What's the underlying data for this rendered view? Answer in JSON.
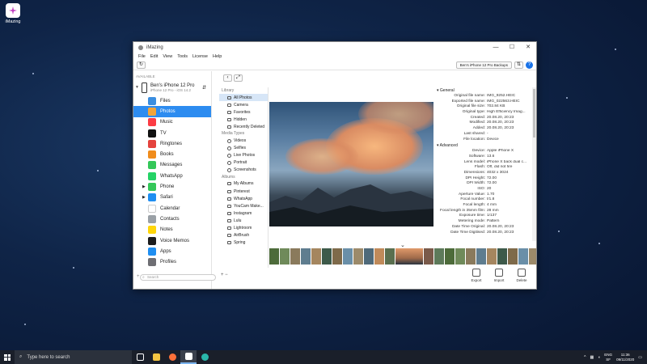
{
  "desktop": {
    "icon_label": "iMazing"
  },
  "window": {
    "title": "iMazing",
    "controls": {
      "minimize": "—",
      "maximize": "☐",
      "close": "✕"
    }
  },
  "menu": [
    "File",
    "Edit",
    "View",
    "Tools",
    "License",
    "Help"
  ],
  "toolbar": {
    "backup_label": "Ben's iPhone 12 Pro Backups"
  },
  "sidebar": {
    "available_label": "AVAILABLE",
    "device_name": "Ben's iPhone 12 Pro",
    "device_sub": "iPhone 12 Pro - iOS 14.2",
    "items": [
      {
        "label": "Files",
        "color": "#3b8ee0",
        "icon": "folder-icon"
      },
      {
        "label": "Photos",
        "color": "#f2a43a",
        "icon": "photos-icon"
      },
      {
        "label": "Music",
        "color": "#fc3c44",
        "icon": "music-icon"
      },
      {
        "label": "TV",
        "color": "#111111",
        "icon": "tv-icon"
      },
      {
        "label": "Ringtones",
        "color": "#e4433d",
        "icon": "ringtones-icon"
      },
      {
        "label": "Books",
        "color": "#f08c1c",
        "icon": "books-icon"
      },
      {
        "label": "Messages",
        "color": "#34c759",
        "icon": "messages-icon"
      },
      {
        "label": "WhatsApp",
        "color": "#25d366",
        "icon": "whatsapp-icon"
      },
      {
        "label": "Phone",
        "color": "#34c759",
        "icon": "phone-icon"
      },
      {
        "label": "Safari",
        "color": "#1f8ef1",
        "icon": "safari-icon"
      },
      {
        "label": "Calendar",
        "color": "#ffffff",
        "icon": "calendar-icon"
      },
      {
        "label": "Contacts",
        "color": "#9aa0a6",
        "icon": "contacts-icon"
      },
      {
        "label": "Notes",
        "color": "#ffd60a",
        "icon": "notes-icon"
      },
      {
        "label": "Voice Memos",
        "color": "#1c1c1e",
        "icon": "voice-memos-icon"
      },
      {
        "label": "Apps",
        "color": "#1f8ef1",
        "icon": "apps-icon"
      },
      {
        "label": "Profiles",
        "color": "#6e6e73",
        "icon": "profiles-icon"
      }
    ],
    "search_placeholder": "Search"
  },
  "library": {
    "library_header": "Library",
    "library_items": [
      "All Photos",
      "Camera",
      "Favorites",
      "Hidden",
      "Recently Deleted"
    ],
    "media_header": "Media Types",
    "media_items": [
      "Videos",
      "Selfies",
      "Live Photos",
      "Portrait",
      "Screenshots"
    ],
    "albums_header": "Albums",
    "album_items": [
      "My Albums",
      "Pinterest",
      "WhatsApp",
      "YouCam Make...",
      "Instagram",
      "Lulu",
      "Lightroom",
      "AirBrush",
      "Spring"
    ]
  },
  "info": {
    "general_header": "General",
    "general": [
      [
        "Original file name:",
        "IMG_9252.HEIC"
      ],
      [
        "Exported file name:",
        "IMG_022563.HEIC"
      ],
      [
        "Original file size:",
        "702.84 KB"
      ],
      [
        "Original type:",
        "High Efficiency Imag..."
      ],
      [
        "Created:",
        "20.08.20, 20:23"
      ],
      [
        "Modified:",
        "20.08.20, 20:23"
      ],
      [
        "Added:",
        "20.08.20, 20:23"
      ],
      [
        "Last shared:",
        "-"
      ],
      [
        "File location:",
        "Device"
      ]
    ],
    "advanced_header": "Advanced",
    "advanced": [
      [
        "Device:",
        "Apple iPhone X"
      ],
      [
        "Software:",
        "13.6"
      ],
      [
        "Lens model:",
        "iPhone X back dual c..."
      ],
      [
        "Flash:",
        "Off, did not fire"
      ],
      [
        "Dimensions:",
        "4032 x 3024"
      ],
      [
        "DPI Height:",
        "72.00"
      ],
      [
        "DPI Width:",
        "72.00"
      ],
      [
        "ISO:",
        "20"
      ],
      [
        "Aperture Value:",
        "1.70"
      ],
      [
        "Focal number:",
        "f/1.8"
      ],
      [
        "Focal length:",
        "4 mm"
      ],
      [
        "Focal length in 35mm film:",
        "28 mm"
      ],
      [
        "Exposure time:",
        "1/137"
      ],
      [
        "Metering mode:",
        "Pattern"
      ],
      [
        "Date Time Original:",
        "20.08.20, 20:23"
      ],
      [
        "Date Time Digitised:",
        "20.08.20, 20:23"
      ]
    ]
  },
  "actions": {
    "export": "Export",
    "import": "Import",
    "delete": "Delete"
  },
  "taskbar": {
    "search_placeholder": "Type here to search",
    "lang_top": "ENG",
    "lang_bottom": "SF",
    "time": "11:36",
    "date": "09/11/2020"
  },
  "colors": {
    "accent": "#2d8cf0",
    "selected_lib": "#d7e6f7",
    "taskbar": "#1a1f2a"
  }
}
